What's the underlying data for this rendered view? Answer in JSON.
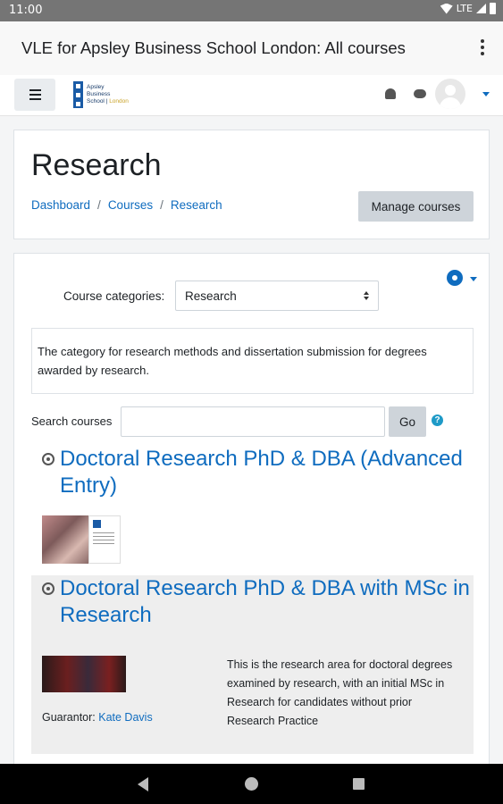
{
  "status_bar": {
    "time": "11:00",
    "network": "LTE"
  },
  "app_bar": {
    "title": "VLE for Apsley Business School London: All courses"
  },
  "navbar": {
    "logo": {
      "line1": "Apsley",
      "line2": "Business",
      "line3": "School",
      "line3_accent": "London"
    }
  },
  "page": {
    "title": "Research",
    "breadcrumb": [
      "Dashboard",
      "Courses",
      "Research"
    ],
    "breadcrumb_separator": "/",
    "manage_button": "Manage courses"
  },
  "categories": {
    "label": "Course categories:",
    "selected": "Research",
    "description": "The category for research methods and dissertation submission for degrees awarded by research."
  },
  "search": {
    "label": "Search courses",
    "value": "",
    "button": "Go",
    "help": "?"
  },
  "courses": [
    {
      "title": "Doctoral Research PhD & DBA (Advanced Entry)"
    },
    {
      "title": "Doctoral Research PhD & DBA with MSc in Research",
      "guarantor_label": "Guarantor:",
      "guarantor_name": "Kate Davis",
      "summary": "This is the research area for doctoral degrees examined by research, with an initial MSc in Research for candidates without prior Research Practice"
    }
  ],
  "colors": {
    "link": "#0f6cbf",
    "button_bg": "#ced4da",
    "status_bar": "#757575"
  }
}
